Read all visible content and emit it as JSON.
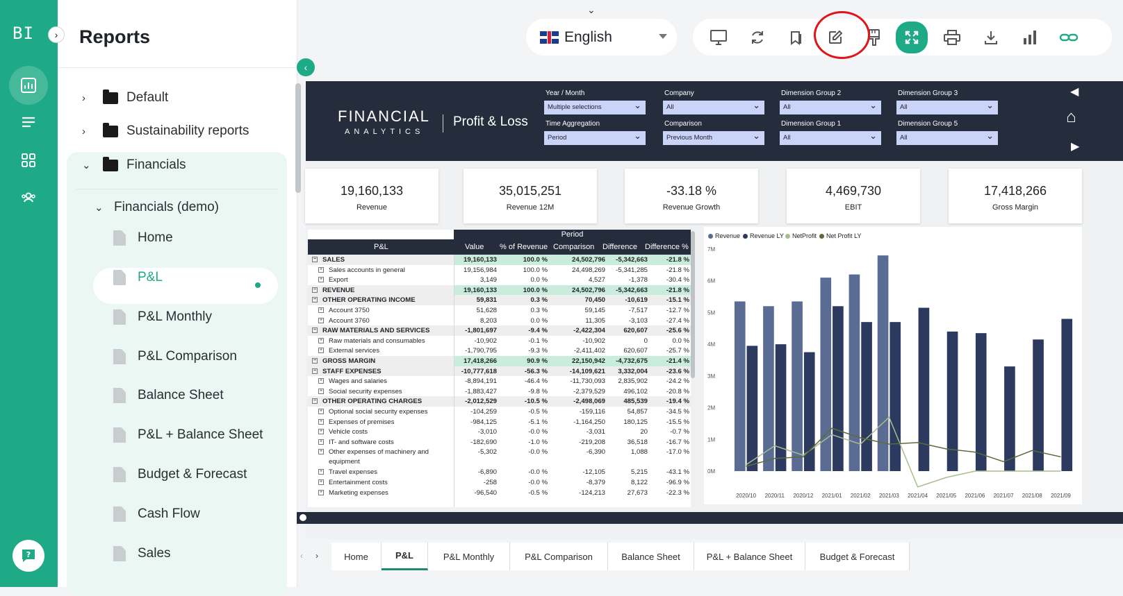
{
  "app": {
    "logo": "BI",
    "section_title": "Reports"
  },
  "sidebar": {
    "folders": [
      {
        "label": "Default",
        "expanded": false
      },
      {
        "label": "Sustainability reports",
        "expanded": false
      },
      {
        "label": "Financials",
        "expanded": true
      }
    ],
    "subfolder": "Financials (demo)",
    "pages": [
      "Home",
      "P&L",
      "P&L Monthly",
      "P&L Comparison",
      "Balance Sheet",
      "P&L + Balance Sheet",
      "Budget & Forecast",
      "Cash Flow",
      "Sales"
    ],
    "active_page": "P&L"
  },
  "topbar": {
    "language": "English",
    "tools": [
      "monitor-icon",
      "refresh-icon",
      "bookmark-icon",
      "edit-icon",
      "format-painter-icon",
      "fullscreen-icon",
      "print-icon",
      "download-icon",
      "chart-bars-icon",
      "link-icon"
    ]
  },
  "report": {
    "brand_main": "FINANCIAL",
    "brand_sub": "ANALYTICS",
    "title": "Profit & Loss",
    "filters": [
      {
        "label": "Year / Month",
        "value": "Multiple selections"
      },
      {
        "label": "Time Aggregation",
        "value": "Period"
      },
      {
        "label": "Company",
        "value": "All"
      },
      {
        "label": "Comparison",
        "value": "Previous Month"
      },
      {
        "label": "Dimension Group 2",
        "value": "All"
      },
      {
        "label": "Dimension Group 1",
        "value": "All"
      },
      {
        "label": "Dimension Group 3",
        "value": "All"
      },
      {
        "label": "Dimension Group 5",
        "value": "All"
      }
    ],
    "kpis": [
      {
        "value": "19,160,133",
        "label": "Revenue"
      },
      {
        "value": "35,015,251",
        "label": "Revenue 12M"
      },
      {
        "value": "-33.18 %",
        "label": "Revenue Growth"
      },
      {
        "value": "4,469,730",
        "label": "EBIT"
      },
      {
        "value": "17,418,266",
        "label": "Gross Margin"
      }
    ],
    "table": {
      "group_header": "Period",
      "columns": [
        "P&L",
        "Value",
        "% of Revenue",
        "Comparison",
        "Difference",
        "Difference %"
      ],
      "rows": [
        {
          "name": "SALES",
          "lvl": 0,
          "bold": true,
          "hl": true,
          "v": [
            "19,160,133",
            "100.0 %",
            "24,502,796",
            "-5,342,663",
            "-21.8 %"
          ]
        },
        {
          "name": "Sales accounts in general",
          "lvl": 1,
          "v": [
            "19,156,984",
            "100.0 %",
            "24,498,269",
            "-5,341,285",
            "-21.8 %"
          ]
        },
        {
          "name": "Export",
          "lvl": 1,
          "v": [
            "3,149",
            "0.0 %",
            "4,527",
            "-1,378",
            "-30.4 %"
          ]
        },
        {
          "name": "REVENUE",
          "lvl": 0,
          "bold": true,
          "hl": true,
          "v": [
            "19,160,133",
            "100.0 %",
            "24,502,796",
            "-5,342,663",
            "-21.8 %"
          ]
        },
        {
          "name": "OTHER OPERATING INCOME",
          "lvl": 0,
          "bold": true,
          "v": [
            "59,831",
            "0.3 %",
            "70,450",
            "-10,619",
            "-15.1 %"
          ]
        },
        {
          "name": "Account 3750",
          "lvl": 1,
          "v": [
            "51,628",
            "0.3 %",
            "59,145",
            "-7,517",
            "-12.7 %"
          ]
        },
        {
          "name": "Account 3760",
          "lvl": 1,
          "v": [
            "8,203",
            "0.0 %",
            "11,305",
            "-3,103",
            "-27.4 %"
          ]
        },
        {
          "name": "RAW MATERIALS AND SERVICES",
          "lvl": 0,
          "bold": true,
          "v": [
            "-1,801,697",
            "-9.4 %",
            "-2,422,304",
            "620,607",
            "-25.6 %"
          ]
        },
        {
          "name": "Raw materials and consumables",
          "lvl": 1,
          "v": [
            "-10,902",
            "-0.1 %",
            "-10,902",
            "0",
            "0.0 %"
          ]
        },
        {
          "name": "External services",
          "lvl": 1,
          "v": [
            "-1,790,795",
            "-9.3 %",
            "-2,411,402",
            "620,607",
            "-25.7 %"
          ]
        },
        {
          "name": "GROSS MARGIN",
          "lvl": 0,
          "bold": true,
          "hl": true,
          "v": [
            "17,418,266",
            "90.9 %",
            "22,150,942",
            "-4,732,675",
            "-21.4 %"
          ]
        },
        {
          "name": "STAFF EXPENSES",
          "lvl": 0,
          "bold": true,
          "v": [
            "-10,777,618",
            "-56.3 %",
            "-14,109,621",
            "3,332,004",
            "-23.6 %"
          ]
        },
        {
          "name": "Wages and salaries",
          "lvl": 1,
          "v": [
            "-8,894,191",
            "-46.4 %",
            "-11,730,093",
            "2,835,902",
            "-24.2 %"
          ]
        },
        {
          "name": "Social security expenses",
          "lvl": 1,
          "v": [
            "-1,883,427",
            "-9.8 %",
            "-2,379,529",
            "496,102",
            "-20.8 %"
          ]
        },
        {
          "name": "OTHER OPERATING CHARGES",
          "lvl": 0,
          "bold": true,
          "v": [
            "-2,012,529",
            "-10.5 %",
            "-2,498,069",
            "485,539",
            "-19.4 %"
          ]
        },
        {
          "name": "Optional social security expenses",
          "lvl": 1,
          "v": [
            "-104,259",
            "-0.5 %",
            "-159,116",
            "54,857",
            "-34.5 %"
          ]
        },
        {
          "name": "Expenses of premises",
          "lvl": 1,
          "v": [
            "-984,125",
            "-5.1 %",
            "-1,164,250",
            "180,125",
            "-15.5 %"
          ]
        },
        {
          "name": "Vehicle costs",
          "lvl": 1,
          "v": [
            "-3,010",
            "-0.0 %",
            "-3,031",
            "20",
            "-0.7 %"
          ]
        },
        {
          "name": "IT- and software costs",
          "lvl": 1,
          "v": [
            "-182,690",
            "-1.0 %",
            "-219,208",
            "36,518",
            "-16.7 %"
          ]
        },
        {
          "name": "Other expenses of machinery and",
          "name2": "equipment",
          "lvl": 1,
          "v": [
            "-5,302",
            "-0.0 %",
            "-6,390",
            "1,088",
            "-17.0 %"
          ]
        },
        {
          "name": "Travel expenses",
          "lvl": 1,
          "v": [
            "-6,890",
            "-0.0 %",
            "-12,105",
            "5,215",
            "-43.1 %"
          ]
        },
        {
          "name": "Entertainment costs",
          "lvl": 1,
          "v": [
            "-258",
            "-0.0 %",
            "-8,379",
            "8,122",
            "-96.9 %"
          ]
        },
        {
          "name": "Marketing expenses",
          "lvl": 1,
          "v": [
            "-96,540",
            "-0.5 %",
            "-124,213",
            "27,673",
            "-22.3 %"
          ]
        }
      ]
    },
    "chart_data": {
      "type": "bar",
      "categories": [
        "2020/10",
        "2020/11",
        "2020/12",
        "2021/01",
        "2021/02",
        "2021/03",
        "2021/04",
        "2021/05",
        "2021/06",
        "2021/07",
        "2021/08",
        "2021/09"
      ],
      "yticks": [
        "0M",
        "1M",
        "2M",
        "3M",
        "4M",
        "5M",
        "6M",
        "7M"
      ],
      "ylim": [
        0,
        7000000
      ],
      "legend_position": "top-left",
      "series": [
        {
          "name": "Revenue",
          "kind": "bar",
          "color": "#5a6b94",
          "values": [
            5350000,
            5200000,
            5350000,
            6100000,
            6200000,
            6800000,
            0,
            0,
            0,
            0,
            0,
            0
          ]
        },
        {
          "name": "Revenue LY",
          "kind": "bar",
          "color": "#2b3a5e",
          "values": [
            3950000,
            4000000,
            3750000,
            5200000,
            4700000,
            4700000,
            5150000,
            4400000,
            4350000,
            3300000,
            4150000,
            4800000
          ]
        },
        {
          "name": "NetProfit",
          "kind": "line",
          "color": "#a7be8b",
          "values": [
            200000,
            800000,
            500000,
            1150000,
            850000,
            1700000,
            -500000,
            -200000,
            0,
            0,
            0,
            0
          ]
        },
        {
          "name": "Net Profit LY",
          "kind": "line",
          "color": "#5d6b3a",
          "values": [
            150000,
            400000,
            450000,
            1350000,
            1050000,
            850000,
            900000,
            700000,
            600000,
            300000,
            650000,
            450000
          ]
        }
      ]
    }
  },
  "tabs": [
    "Home",
    "P&L",
    "P&L Monthly",
    "P&L Comparison",
    "Balance Sheet",
    "P&L + Balance Sheet",
    "Budget & Forecast"
  ],
  "active_tab": "P&L",
  "colors": {
    "accent": "#1eaa86",
    "navy": "#252d3c",
    "highlight": "#c9ecdc",
    "annotation": "#e0141a"
  }
}
